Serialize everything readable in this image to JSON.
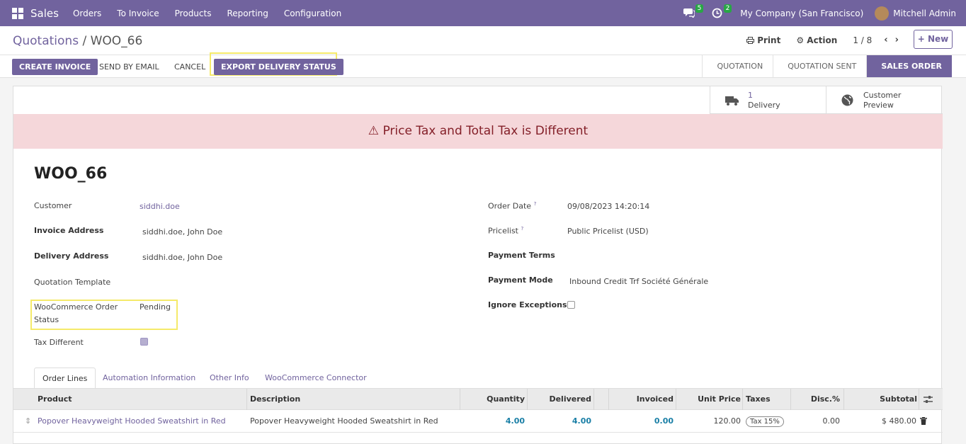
{
  "nav": {
    "brand": "Sales",
    "menu": [
      "Orders",
      "To Invoice",
      "Products",
      "Reporting",
      "Configuration"
    ],
    "messages_count": "5",
    "activities_count": "2",
    "company": "My Company (San Francisco)",
    "user": "Mitchell Admin"
  },
  "control": {
    "breadcrumb_parent": "Quotations",
    "breadcrumb_sep": " / ",
    "breadcrumb_current": "WOO_66",
    "print": "Print",
    "action": "Action",
    "pager": "1 / 8",
    "new": "New"
  },
  "statusbar": {
    "create_invoice": "CREATE INVOICE",
    "send_email": "SEND BY EMAIL",
    "cancel": "CANCEL",
    "export_delivery": "EXPORT DELIVERY STATUS",
    "stages": [
      "QUOTATION",
      "QUOTATION SENT",
      "SALES ORDER"
    ]
  },
  "smart_buttons": {
    "delivery_count": "1",
    "delivery_label": "Delivery",
    "customer_label": "Customer",
    "preview_label": "Preview"
  },
  "alert": "Price Tax and Total Tax is Different",
  "record": {
    "title": "WOO_66",
    "customer_label": "Customer",
    "customer": "siddhi.doe",
    "invoice_address_label": "Invoice Address",
    "invoice_address": "siddhi.doe, John Doe",
    "delivery_address_label": "Delivery Address",
    "delivery_address": "siddhi.doe, John Doe",
    "quotation_template_label": "Quotation Template",
    "woo_status_label_1": "WooCommerce Order",
    "woo_status_label_2": "Status",
    "woo_status": "Pending",
    "tax_different_label": "Tax Different",
    "order_date_label": "Order Date",
    "order_date": "09/08/2023 14:20:14",
    "pricelist_label": "Pricelist",
    "pricelist": "Public Pricelist (USD)",
    "payment_terms_label": "Payment Terms",
    "payment_mode_label": "Payment Mode",
    "payment_mode": "Inbound Credit Trf Société Générale",
    "ignore_exceptions_label": "Ignore Exceptions",
    "help_mark": "?"
  },
  "tabs": [
    "Order Lines",
    "Automation Information",
    "Other Info",
    "WooCommerce Connector"
  ],
  "table": {
    "headers": [
      "Product",
      "Description",
      "Quantity",
      "Delivered",
      "Invoiced",
      "Unit Price",
      "Taxes",
      "Disc.%",
      "Subtotal"
    ],
    "row": {
      "product": "Popover Heavyweight Hooded Sweatshirt in Red",
      "description": "Popover Heavyweight Hooded Sweatshirt in Red",
      "quantity": "4.00",
      "delivered": "4.00",
      "invoiced": "0.00",
      "unit_price": "120.00",
      "taxes": "Tax 15%",
      "discount": "0.00",
      "subtotal": "$ 480.00"
    }
  },
  "colors": {
    "primary": "#71639e",
    "alert_bg": "#f5d7da",
    "alert_text": "#842029",
    "highlight": "#f5ea6a"
  }
}
